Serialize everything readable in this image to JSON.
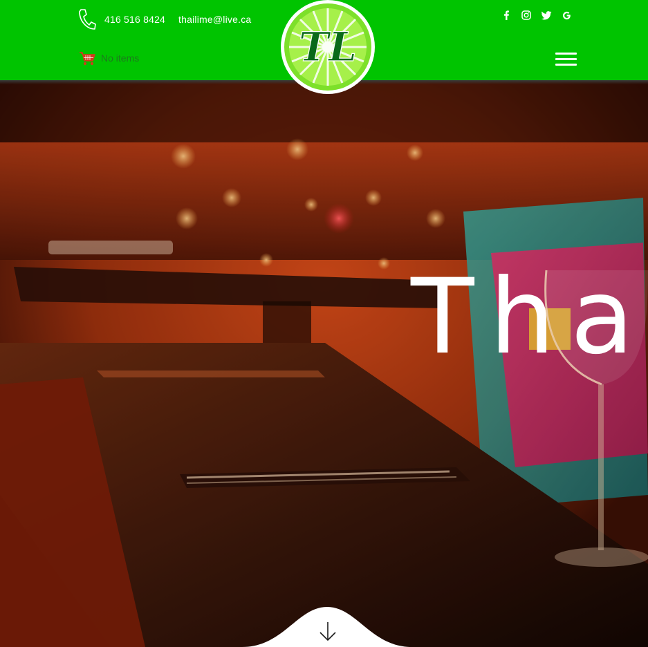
{
  "header": {
    "phone": "416 516 8424",
    "email": "thailime@live.ca",
    "cart_label": "No items",
    "logo_text": "TL",
    "social": [
      "facebook-icon",
      "instagram-icon",
      "twitter-icon",
      "google-icon"
    ],
    "menu_icon": "hamburger-menu-icon"
  },
  "hero": {
    "title": "Thai",
    "scroll_icon": "arrow-down-icon"
  },
  "colors": {
    "header_bg": "#00c400",
    "logo_green": "#7de02a",
    "logo_dark": "#0a6a1a",
    "text_white": "#ffffff",
    "cart_red": "#d23a1c"
  }
}
